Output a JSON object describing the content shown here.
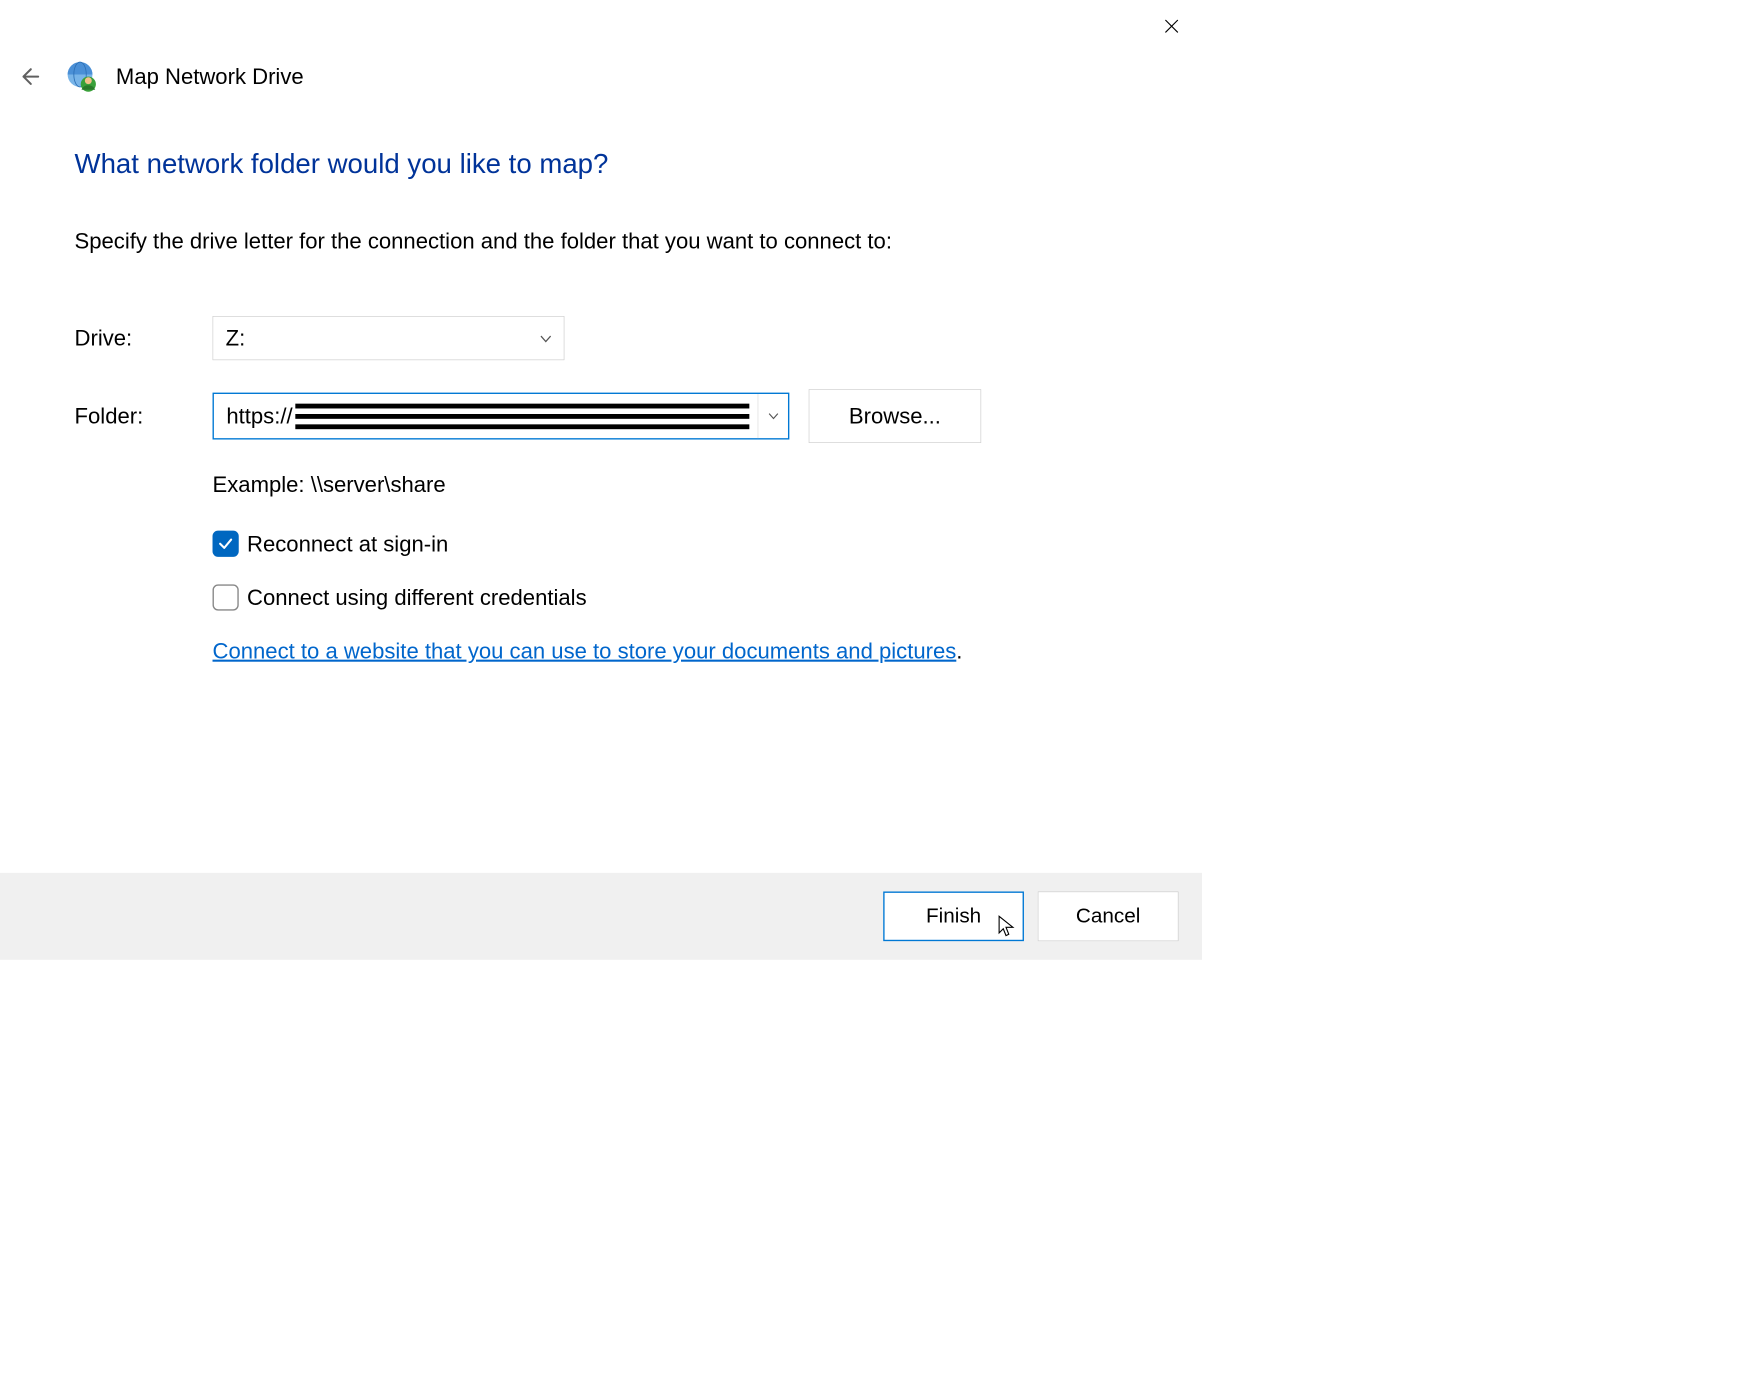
{
  "window": {
    "title": "Map Network Drive"
  },
  "heading": "What network folder would you like to map?",
  "instruction": "Specify the drive letter for the connection and the folder that you want to connect to:",
  "form": {
    "drive_label": "Drive:",
    "drive_value": "Z:",
    "folder_label": "Folder:",
    "folder_prefix": "https://",
    "browse_label": "Browse...",
    "example": "Example: \\\\server\\share",
    "reconnect_label": "Reconnect at sign-in",
    "reconnect_checked": true,
    "credentials_label": "Connect using different credentials",
    "credentials_checked": false,
    "link": "Connect to a website that you can use to store your documents and pictures"
  },
  "buttons": {
    "finish": "Finish",
    "cancel": "Cancel"
  }
}
